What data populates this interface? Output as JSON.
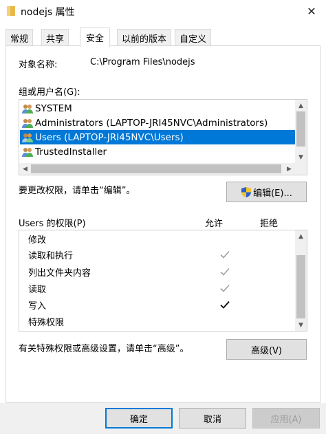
{
  "window": {
    "title": "nodejs 属性",
    "close_glyph": "✕",
    "folder_icon": "folder-icon"
  },
  "tabs": [
    {
      "label": "常规"
    },
    {
      "label": "共享"
    },
    {
      "label": "安全"
    },
    {
      "label": "以前的版本"
    },
    {
      "label": "自定义"
    }
  ],
  "active_tab": "安全",
  "object": {
    "label": "对象名称:",
    "value": "C:\\Program Files\\nodejs"
  },
  "groups": {
    "label": "组或用户名(G):",
    "items": [
      {
        "name": "SYSTEM"
      },
      {
        "name": "Administrators (LAPTOP-JRI45NVC\\Administrators)"
      },
      {
        "name": "Users (LAPTOP-JRI45NVC\\Users)"
      },
      {
        "name": "TrustedInstaller"
      }
    ],
    "selected": "Users (LAPTOP-JRI45NVC\\Users)"
  },
  "edit": {
    "hint": "要更改权限，请单击“编辑”。",
    "button_label": "编辑(E)..."
  },
  "permissions": {
    "header": "Users 的权限(P)",
    "allow_header": "允许",
    "deny_header": "拒绝",
    "rows": [
      {
        "name": "修改",
        "allow": "none"
      },
      {
        "name": "读取和执行",
        "allow": "inherited"
      },
      {
        "name": "列出文件夹内容",
        "allow": "inherited"
      },
      {
        "name": "读取",
        "allow": "inherited"
      },
      {
        "name": "写入",
        "allow": "explicit"
      },
      {
        "name": "特殊权限",
        "allow": "none"
      }
    ]
  },
  "advanced": {
    "hint": "有关特殊权限或高级设置，请单击“高级”。",
    "button_label": "高级(V)"
  },
  "footer": {
    "ok_label": "确定",
    "cancel_label": "取消",
    "apply_label": "应用(A)"
  },
  "colors": {
    "selection": "#0078d7",
    "check_inherited": "#a0a0a0",
    "check_explicit": "#000000"
  }
}
